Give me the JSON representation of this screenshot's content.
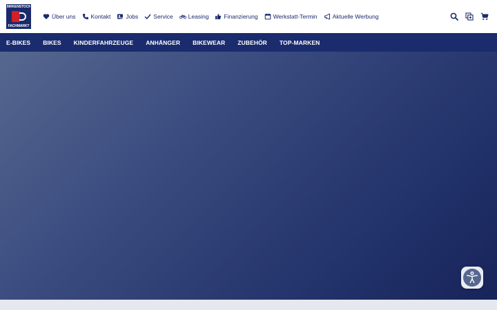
{
  "logo": {
    "text_top": "BIRKENSTOCK",
    "text_bottom": "FACHMARKT"
  },
  "top_nav": [
    {
      "label": "Über uns",
      "icon": "heart-icon"
    },
    {
      "label": "Kontakt",
      "icon": "phone-icon"
    },
    {
      "label": "Jobs",
      "icon": "jobs-icon"
    },
    {
      "label": "Service",
      "icon": "check-icon"
    },
    {
      "label": "Leasing",
      "icon": "bicycle-icon"
    },
    {
      "label": "Finanzierung",
      "icon": "thumbs-up-icon"
    },
    {
      "label": "Werkstatt-Termin",
      "icon": "calendar-icon"
    },
    {
      "label": "Aktuelle Werbung",
      "icon": "megaphone-icon"
    }
  ],
  "top_icons": [
    "search-icon",
    "compare-icon",
    "cart-icon"
  ],
  "main_nav": [
    "E-BIKES",
    "BIKES",
    "KINDERFAHRZEUGE",
    "ANHÄNGER",
    "BIKEWEAR",
    "ZUBEHÖR",
    "TOP-MARKEN"
  ],
  "colors": {
    "brand_navy": "#1a2c6e",
    "logo_red": "#d32027",
    "hero_start": "#56678f",
    "hero_end": "#17245a"
  },
  "accessibility_button": {
    "icon": "accessibility-icon"
  }
}
